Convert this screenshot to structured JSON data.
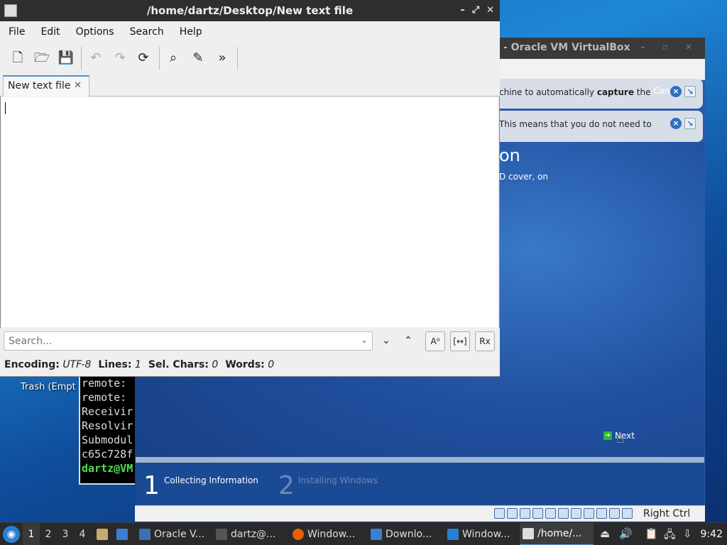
{
  "desktop": {
    "trash_label": "Trash (Empt"
  },
  "terminal": {
    "lines": [
      "remote:",
      "remote:",
      "Receivir",
      "Resolvir",
      "Submodul",
      "c65c728f"
    ],
    "prompt": "dartz@VM"
  },
  "virtualbox": {
    "title": "- Oracle VM VirtualBox",
    "notice1_pre": "chine to automatically ",
    "notice1_bold": "capture",
    "notice1_post": " the",
    "notice1_cancel": "Canc",
    "notice2": "This means that you do not need to",
    "heading": "on",
    "subtext": "D cover, on",
    "next_label": "Next",
    "step1_num": "1",
    "step1_label": "Collecting Information",
    "step2_num": "2",
    "step2_label": "Installing Windows",
    "host_key": "Right Ctrl"
  },
  "editor": {
    "title": "/home/dartz/Desktop/New text file",
    "menu": [
      "File",
      "Edit",
      "Options",
      "Search",
      "Help"
    ],
    "tab_label": "New text file",
    "search_placeholder": "Search...",
    "status": {
      "encoding_label": "Encoding:",
      "encoding_value": "UTF-8",
      "lines_label": "Lines:",
      "lines_value": "1",
      "sel_label": "Sel. Chars:",
      "sel_value": "0",
      "words_label": "Words:",
      "words_value": "0"
    }
  },
  "taskbar": {
    "workspaces": [
      "1",
      "2",
      "3",
      "4"
    ],
    "items": [
      {
        "label": "Oracle V...",
        "icon": "virtualbox-icon"
      },
      {
        "label": "dartz@...",
        "icon": "terminal-icon"
      },
      {
        "label": "Window...",
        "icon": "firefox-icon"
      },
      {
        "label": "Downlo...",
        "icon": "folder-icon"
      },
      {
        "label": "Window...",
        "icon": "windows-setup-icon"
      },
      {
        "label": "/home/...",
        "icon": "text-editor-icon"
      }
    ],
    "clock": "9:42"
  }
}
